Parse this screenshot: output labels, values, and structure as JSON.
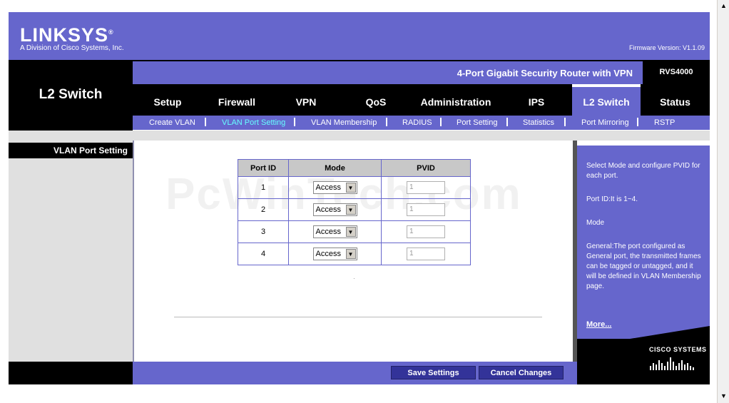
{
  "header": {
    "brand": "LINKSYS",
    "registered": "®",
    "tagline": "A Division of Cisco Systems, Inc.",
    "firmware": "Firmware Version: V1.1.09"
  },
  "section_title": "L2 Switch",
  "product": {
    "name": "4-Port Gigabit Security Router with VPN",
    "model": "RVS4000"
  },
  "tabs": [
    {
      "label": "Setup"
    },
    {
      "label": "Firewall"
    },
    {
      "label": "VPN"
    },
    {
      "label": "QoS"
    },
    {
      "label": "Administration"
    },
    {
      "label": "IPS"
    },
    {
      "label": "L2 Switch"
    },
    {
      "label": "Status"
    }
  ],
  "subtabs": [
    {
      "label": "Create VLAN"
    },
    {
      "label": "VLAN Port Setting"
    },
    {
      "label": "VLAN Membership"
    },
    {
      "label": "RADIUS"
    },
    {
      "label": "Port Setting"
    },
    {
      "label": "Statistics"
    },
    {
      "label": "Port Mirroring"
    },
    {
      "label": "RSTP"
    }
  ],
  "left_label": "VLAN Port Setting",
  "watermark": "PcWinTech.com",
  "table": {
    "headers": [
      "Port ID",
      "Mode",
      "PVID"
    ],
    "rows": [
      {
        "port": "1",
        "mode": "Access",
        "pvid": "1"
      },
      {
        "port": "2",
        "mode": "Access",
        "pvid": "1"
      },
      {
        "port": "3",
        "mode": "Access",
        "pvid": "1"
      },
      {
        "port": "4",
        "mode": "Access",
        "pvid": "1"
      }
    ]
  },
  "help": {
    "intro": "Select Mode and configure PVID for each port.",
    "port_id": "Port ID:It is 1~4.",
    "mode": "Mode",
    "general": "General:The port configured as General port, the transmitted frames can be tagged or untagged, and it will be defined in VLAN Membership page.",
    "more": "More..."
  },
  "cisco": "CISCO SYSTEMS",
  "buttons": {
    "save": "Save Settings",
    "cancel": "Cancel Changes"
  },
  "colors": {
    "brand": "#6666cc",
    "active_sub": "#66ffff",
    "button": "#333399"
  }
}
